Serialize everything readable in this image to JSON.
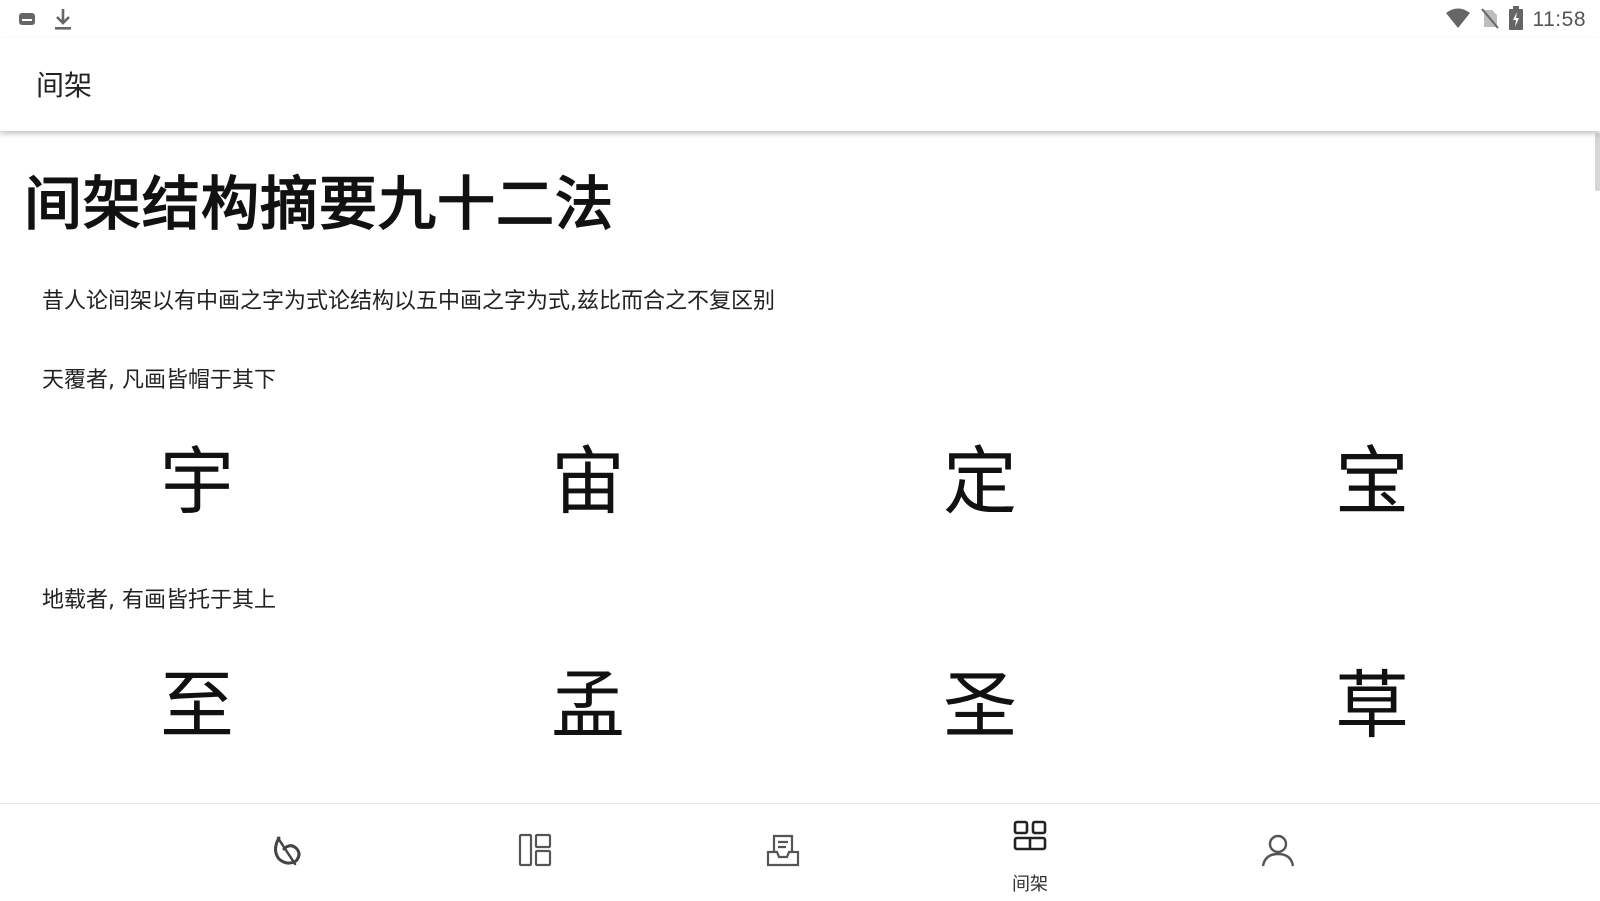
{
  "status_bar": {
    "time": "11:58",
    "left_icons": [
      "keyboard-icon",
      "download-icon"
    ],
    "right_icons": [
      "wifi-icon",
      "no-sim-icon",
      "battery-charging-icon"
    ]
  },
  "app_bar": {
    "title": "间架"
  },
  "page": {
    "title": "间架结构摘要九十二法",
    "intro": "昔人论间架以有中画之字为式论结构以五中画之字为式,兹比而合之不复区别",
    "sections": [
      {
        "label": "天覆者, 凡画皆帽于其下",
        "chars": [
          "宇",
          "宙",
          "定",
          "宝"
        ]
      },
      {
        "label": "地载者, 有画皆托于其上",
        "chars": [
          "至",
          "孟",
          "圣",
          "草"
        ]
      }
    ]
  },
  "bottom_nav": {
    "items": [
      {
        "icon": "brush-stroke-icon",
        "label": ""
      },
      {
        "icon": "layout-icon",
        "label": ""
      },
      {
        "icon": "inbox-document-icon",
        "label": ""
      },
      {
        "icon": "grid-icon",
        "label": "间架",
        "active": true
      },
      {
        "icon": "user-icon",
        "label": ""
      }
    ]
  }
}
